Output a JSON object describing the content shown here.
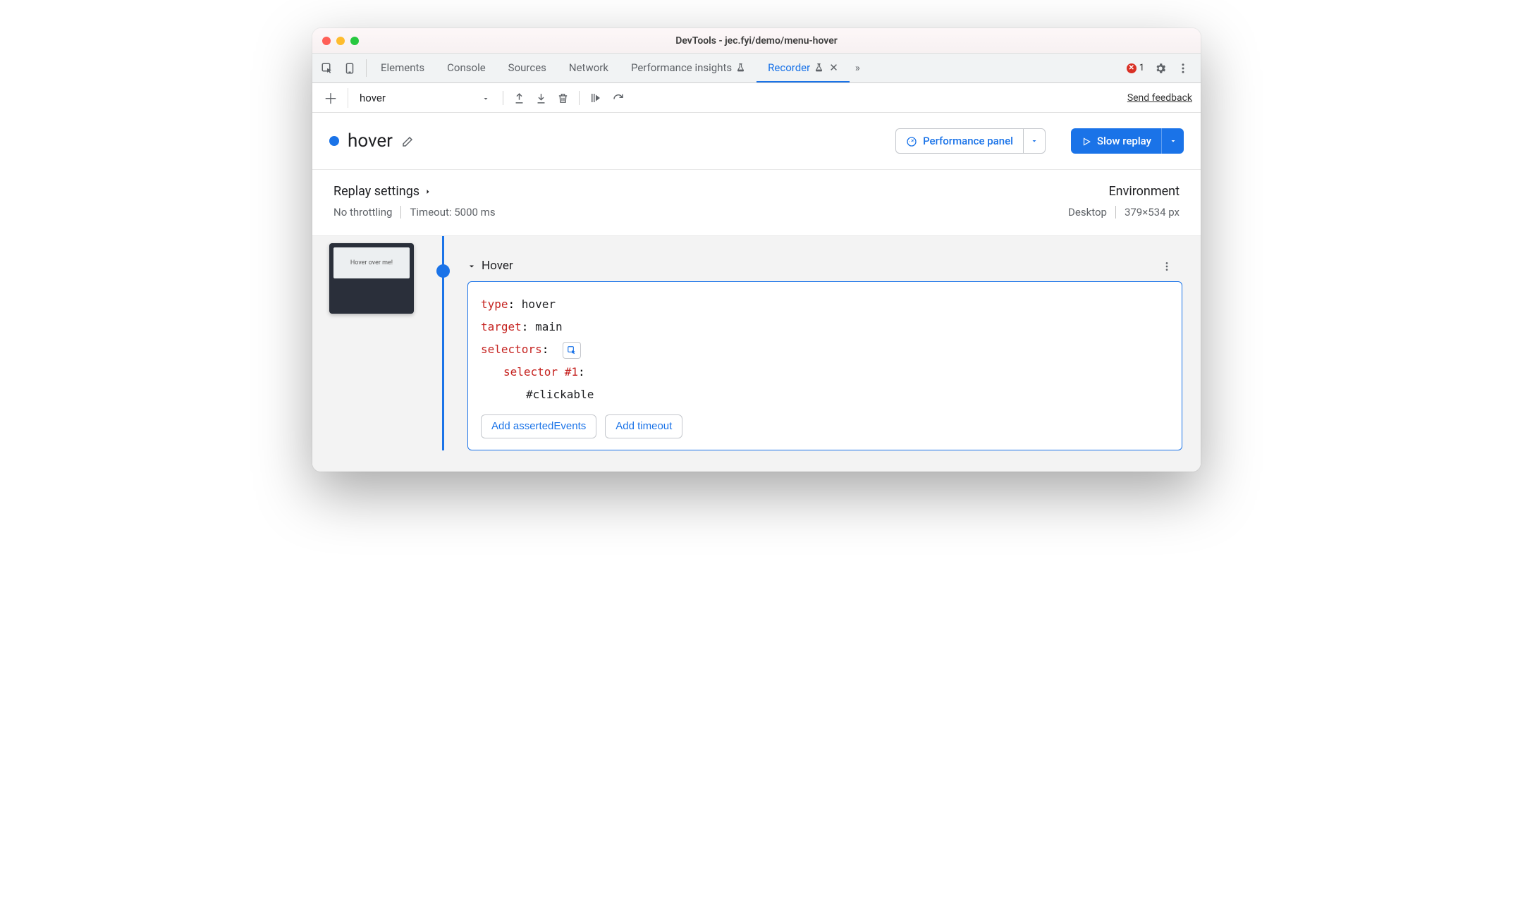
{
  "window": {
    "title": "DevTools - jec.fyi/demo/menu-hover"
  },
  "tabs": {
    "items": [
      {
        "label": "Elements"
      },
      {
        "label": "Console"
      },
      {
        "label": "Sources"
      },
      {
        "label": "Network"
      },
      {
        "label": "Performance insights",
        "flask": true
      },
      {
        "label": "Recorder",
        "flask": true,
        "active": true,
        "closable": true
      }
    ],
    "overflow_icon": "»",
    "error_count": "1"
  },
  "toolbar": {
    "recording_name": "hover",
    "feedback_label": "Send feedback"
  },
  "header": {
    "title": "hover",
    "perf_button": "Performance panel",
    "replay_button": "Slow replay"
  },
  "settings": {
    "left_heading": "Replay settings",
    "throttling": "No throttling",
    "timeout": "Timeout: 5000 ms",
    "right_heading": "Environment",
    "device": "Desktop",
    "dimensions": "379×534 px"
  },
  "step": {
    "thumb_text": "Hover over me!",
    "title": "Hover",
    "props": {
      "type_key": "type",
      "type_val": "hover",
      "target_key": "target",
      "target_val": "main",
      "selectors_key": "selectors",
      "selector1_key": "selector #1",
      "selector1_val": "#clickable"
    },
    "add_asserted": "Add assertedEvents",
    "add_timeout": "Add timeout"
  }
}
